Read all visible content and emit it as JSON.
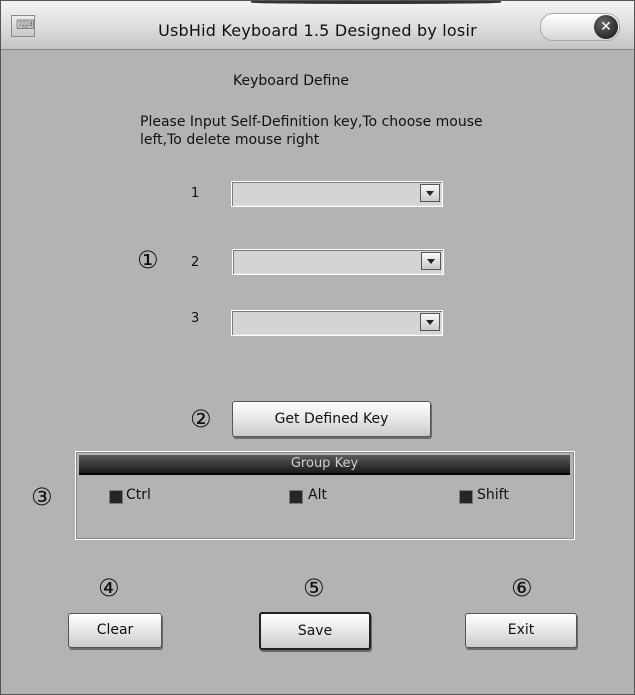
{
  "window": {
    "title": "UsbHid Keyboard 1.5 Designed by losir",
    "app_icon": "keyboard-app-icon",
    "close_glyph": "✕"
  },
  "header": {
    "title": "Keyboard Define",
    "description": "Please Input Self-Definition key,To choose mouse\nleft,To delete  mouse right"
  },
  "keys": {
    "rows": [
      {
        "label": "1",
        "value": ""
      },
      {
        "label": "2",
        "value": ""
      },
      {
        "label": "3",
        "value": ""
      }
    ]
  },
  "markers": {
    "m1": "①",
    "m2": "②",
    "m3": "③",
    "m4": "④",
    "m5": "⑤",
    "m6": "⑥"
  },
  "buttons": {
    "get_defined": "Get Defined Key",
    "clear": "Clear",
    "save": "Save",
    "exit": "Exit"
  },
  "group": {
    "title": "Group Key",
    "ctrl": "Ctrl",
    "alt": "Alt",
    "shift": "Shift"
  }
}
